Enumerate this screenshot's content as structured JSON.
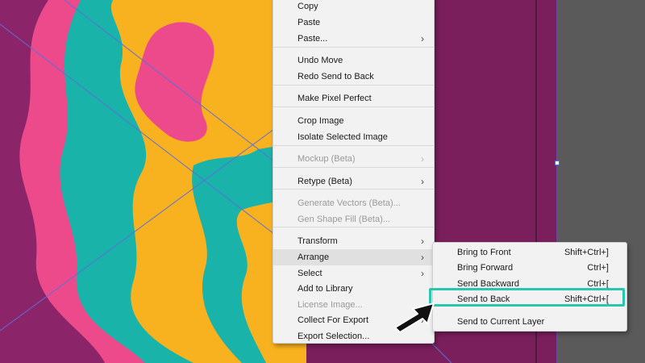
{
  "colors": {
    "artboard": "#7b1f5c",
    "pasteboard": "#5a5a5a",
    "highlight": "#2cc6ae"
  },
  "context_menu": {
    "items": [
      {
        "label": "Copy",
        "disabled": false
      },
      {
        "label": "Paste",
        "disabled": false
      },
      {
        "label": "Paste...",
        "disabled": false,
        "submenu": true
      },
      {
        "label": "Undo Move",
        "disabled": false
      },
      {
        "label": "Redo Send to Back",
        "disabled": false
      },
      {
        "label": "Make Pixel Perfect",
        "disabled": false
      },
      {
        "label": "Crop Image",
        "disabled": false
      },
      {
        "label": "Isolate Selected Image",
        "disabled": false
      },
      {
        "label": "Mockup (Beta)",
        "disabled": true,
        "submenu": true
      },
      {
        "label": "Retype (Beta)",
        "disabled": false,
        "submenu": true
      },
      {
        "label": "Generate Vectors (Beta)...",
        "disabled": true
      },
      {
        "label": "Gen Shape Fill (Beta)...",
        "disabled": true
      },
      {
        "label": "Transform",
        "disabled": false,
        "submenu": true
      },
      {
        "label": "Arrange",
        "disabled": false,
        "submenu": true,
        "active": true
      },
      {
        "label": "Select",
        "disabled": false,
        "submenu": true
      },
      {
        "label": "Add to Library",
        "disabled": false
      },
      {
        "label": "License Image...",
        "disabled": true
      },
      {
        "label": "Collect For Export",
        "disabled": false,
        "submenu": true
      },
      {
        "label": "Export Selection...",
        "disabled": false
      }
    ],
    "arrow_glyph": "›"
  },
  "arrange_submenu": {
    "items": [
      {
        "label": "Bring to Front",
        "shortcut": "Shift+Ctrl+]"
      },
      {
        "label": "Bring Forward",
        "shortcut": "Ctrl+]"
      },
      {
        "label": "Send Backward",
        "shortcut": "Ctrl+["
      },
      {
        "label": "Send to Back",
        "shortcut": "Shift+Ctrl+[",
        "highlighted": true
      },
      {
        "label": "Send to Current Layer",
        "shortcut": ""
      }
    ]
  }
}
